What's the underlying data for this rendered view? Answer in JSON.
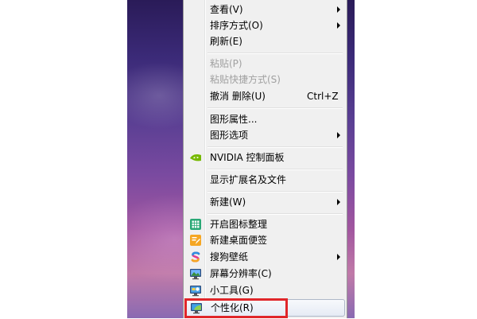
{
  "menu": {
    "items": [
      {
        "label": "查看(V)",
        "submenu": true
      },
      {
        "label": "排序方式(O)",
        "submenu": true
      },
      {
        "label": "刷新(E)"
      },
      {
        "label": "粘贴(P)",
        "disabled": true
      },
      {
        "label": "粘贴快捷方式(S)",
        "disabled": true
      },
      {
        "label": "撤消 删除(U)",
        "shortcut": "Ctrl+Z"
      },
      {
        "label": "图形属性..."
      },
      {
        "label": "图形选项",
        "submenu": true
      },
      {
        "label": "NVIDIA 控制面板",
        "icon": "nvidia-icon"
      },
      {
        "label": "显示扩展名及文件"
      },
      {
        "label": "新建(W)",
        "submenu": true
      },
      {
        "label": "开启图标整理",
        "icon": "grid-icon"
      },
      {
        "label": "新建桌面便签",
        "icon": "note-icon"
      },
      {
        "label": "搜狗壁纸",
        "icon": "sogou-wallpaper-icon",
        "submenu": true
      },
      {
        "label": "屏幕分辨率(C)",
        "icon": "monitor-icon"
      },
      {
        "label": "小工具(G)",
        "icon": "gadgets-icon"
      },
      {
        "label": "个性化(R)",
        "icon": "personalize-icon",
        "highlighted": true
      }
    ]
  },
  "colors": {
    "highlight_box": "#e0262a",
    "menu_bg": "#f0f0f0"
  }
}
